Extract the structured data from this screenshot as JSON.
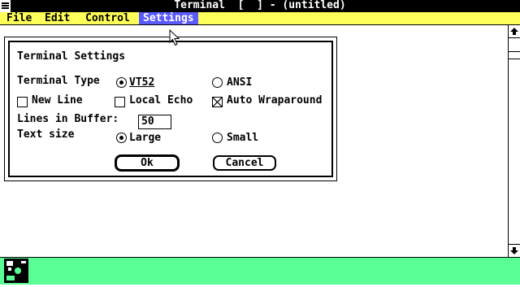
{
  "window": {
    "title": "Terminal  [  ] - (untitled)"
  },
  "menu": {
    "items": [
      "File",
      "Edit",
      "Control",
      "Settings"
    ],
    "active_index": 3
  },
  "dialog": {
    "title": "Terminal Settings",
    "terminal_type_label": "Terminal Type",
    "vt52_label": "VT52",
    "ansi_label": "ANSI",
    "terminal_type_selected": "VT52",
    "new_line_label": "New Line",
    "new_line_checked": false,
    "local_echo_label": "Local Echo",
    "local_echo_checked": false,
    "auto_wrap_label": "Auto Wraparound",
    "auto_wrap_checked": true,
    "lines_label": "Lines in Buffer:",
    "lines_value": "50",
    "text_size_label": "Text size",
    "large_label": "Large",
    "small_label": "Small",
    "text_size_selected": "Large",
    "ok_label": "Ok",
    "cancel_label": "Cancel"
  },
  "colors": {
    "menubar": "#ffff5a",
    "menu_active": "#5a5aff",
    "icon_area": "#5aff96"
  },
  "icons": [
    "system-menu-icon",
    "scroll-up-arrow-icon",
    "scroll-down-arrow-icon",
    "terminal-app-icon",
    "mouse-pointer-icon"
  ]
}
